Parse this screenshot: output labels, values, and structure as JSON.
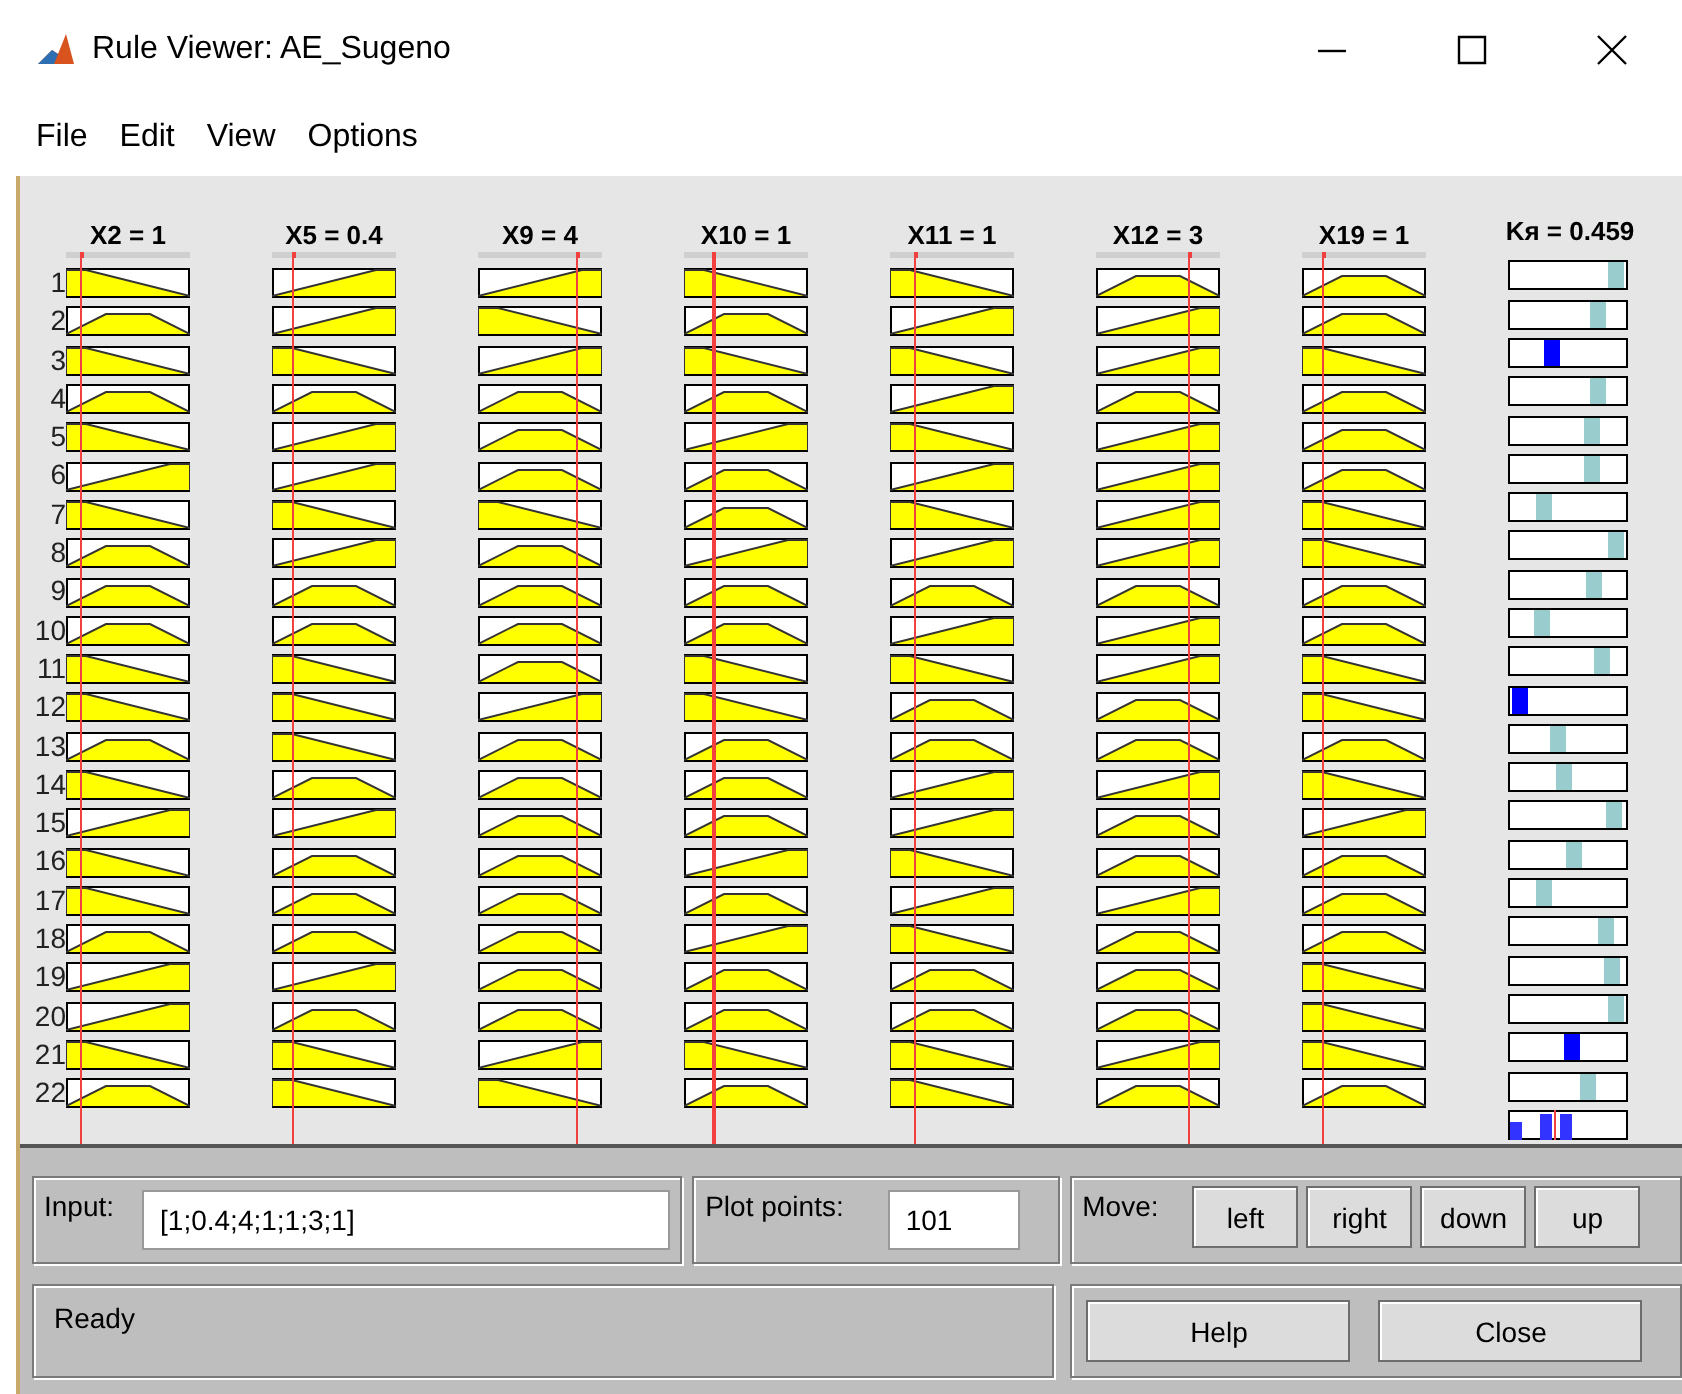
{
  "window": {
    "title": "Rule Viewer: AE_Sugeno"
  },
  "menu": [
    "File",
    "Edit",
    "View",
    "Options"
  ],
  "inputs": [
    {
      "label": "X2 = 1",
      "level": 0.11
    },
    {
      "label": "X5 = 0.4",
      "level": 0.16
    },
    {
      "label": "X9 = 4",
      "level": 0.79
    },
    {
      "label": "X10 = 1",
      "level": 0.23
    },
    {
      "label": "X11 = 1",
      "level": 0.19
    },
    {
      "label": "X12 = 3",
      "level": 0.74
    },
    {
      "label": "X19 = 1",
      "level": 0.16
    }
  ],
  "output": {
    "label": "Kя = 0.459"
  },
  "rules": [
    {
      "label": "1",
      "mfs": [
        {
          "kind": "down"
        },
        {
          "kind": "up"
        },
        {
          "kind": "up"
        },
        {
          "kind": "down"
        },
        {
          "kind": "down"
        },
        {
          "kind": "mid"
        },
        {
          "kind": "mid"
        }
      ],
      "output": {
        "level": 0.98,
        "active": false
      }
    },
    {
      "label": "2",
      "mfs": [
        {
          "kind": "mid"
        },
        {
          "kind": "up"
        },
        {
          "kind": "down"
        },
        {
          "kind": "mid"
        },
        {
          "kind": "up"
        },
        {
          "kind": "up"
        },
        {
          "kind": "mid"
        }
      ],
      "output": {
        "level": 0.8,
        "active": false
      }
    },
    {
      "label": "3",
      "mfs": [
        {
          "kind": "down"
        },
        {
          "kind": "down"
        },
        {
          "kind": "up"
        },
        {
          "kind": "down"
        },
        {
          "kind": "down"
        },
        {
          "kind": "up"
        },
        {
          "kind": "down"
        }
      ],
      "output": {
        "level": 0.33,
        "active": true
      }
    },
    {
      "label": "4",
      "mfs": [
        {
          "kind": "mid"
        },
        {
          "kind": "mid"
        },
        {
          "kind": "mid"
        },
        {
          "kind": "mid"
        },
        {
          "kind": "up"
        },
        {
          "kind": "mid"
        },
        {
          "kind": "mid"
        }
      ],
      "output": {
        "level": 0.79,
        "active": false
      }
    },
    {
      "label": "5",
      "mfs": [
        {
          "kind": "down"
        },
        {
          "kind": "up"
        },
        {
          "kind": "mid"
        },
        {
          "kind": "up"
        },
        {
          "kind": "down"
        },
        {
          "kind": "up"
        },
        {
          "kind": "mid"
        }
      ],
      "output": {
        "level": 0.73,
        "active": false
      }
    },
    {
      "label": "6",
      "mfs": [
        {
          "kind": "up"
        },
        {
          "kind": "up"
        },
        {
          "kind": "mid"
        },
        {
          "kind": "mid"
        },
        {
          "kind": "up"
        },
        {
          "kind": "up"
        },
        {
          "kind": "mid"
        }
      ],
      "output": {
        "level": 0.73,
        "active": false
      }
    },
    {
      "label": "7",
      "mfs": [
        {
          "kind": "down"
        },
        {
          "kind": "down"
        },
        {
          "kind": "down"
        },
        {
          "kind": "mid"
        },
        {
          "kind": "down"
        },
        {
          "kind": "up"
        },
        {
          "kind": "down"
        }
      ],
      "output": {
        "level": 0.25,
        "active": false
      }
    },
    {
      "label": "8",
      "mfs": [
        {
          "kind": "mid"
        },
        {
          "kind": "up"
        },
        {
          "kind": "mid"
        },
        {
          "kind": "up"
        },
        {
          "kind": "up"
        },
        {
          "kind": "up"
        },
        {
          "kind": "down"
        }
      ],
      "output": {
        "level": 0.98,
        "active": false
      }
    },
    {
      "label": "9",
      "mfs": [
        {
          "kind": "mid"
        },
        {
          "kind": "mid"
        },
        {
          "kind": "mid"
        },
        {
          "kind": "mid"
        },
        {
          "kind": "mid"
        },
        {
          "kind": "mid"
        },
        {
          "kind": "mid"
        }
      ],
      "output": {
        "level": 0.75,
        "active": false
      }
    },
    {
      "label": "10",
      "mfs": [
        {
          "kind": "mid"
        },
        {
          "kind": "mid"
        },
        {
          "kind": "mid"
        },
        {
          "kind": "mid"
        },
        {
          "kind": "up"
        },
        {
          "kind": "up"
        },
        {
          "kind": "mid"
        }
      ],
      "output": {
        "level": 0.23,
        "active": false
      }
    },
    {
      "label": "11",
      "mfs": [
        {
          "kind": "down"
        },
        {
          "kind": "down"
        },
        {
          "kind": "mid"
        },
        {
          "kind": "down"
        },
        {
          "kind": "down"
        },
        {
          "kind": "up"
        },
        {
          "kind": "down"
        }
      ],
      "output": {
        "level": 0.83,
        "active": false
      }
    },
    {
      "label": "12",
      "mfs": [
        {
          "kind": "down"
        },
        {
          "kind": "down"
        },
        {
          "kind": "up"
        },
        {
          "kind": "down"
        },
        {
          "kind": "mid"
        },
        {
          "kind": "mid"
        },
        {
          "kind": "down"
        }
      ],
      "output": {
        "level": 0.02,
        "active": true
      }
    },
    {
      "label": "13",
      "mfs": [
        {
          "kind": "mid"
        },
        {
          "kind": "down"
        },
        {
          "kind": "mid"
        },
        {
          "kind": "mid"
        },
        {
          "kind": "mid"
        },
        {
          "kind": "mid"
        },
        {
          "kind": "mid"
        }
      ],
      "output": {
        "level": 0.4,
        "active": false
      }
    },
    {
      "label": "14",
      "mfs": [
        {
          "kind": "down"
        },
        {
          "kind": "mid"
        },
        {
          "kind": "mid"
        },
        {
          "kind": "mid"
        },
        {
          "kind": "up"
        },
        {
          "kind": "up"
        },
        {
          "kind": "down"
        }
      ],
      "output": {
        "level": 0.46,
        "active": false
      }
    },
    {
      "label": "15",
      "mfs": [
        {
          "kind": "up"
        },
        {
          "kind": "up"
        },
        {
          "kind": "mid"
        },
        {
          "kind": "mid"
        },
        {
          "kind": "up"
        },
        {
          "kind": "mid"
        },
        {
          "kind": "up"
        }
      ],
      "output": {
        "level": 0.96,
        "active": false
      }
    },
    {
      "label": "16",
      "mfs": [
        {
          "kind": "down"
        },
        {
          "kind": "mid"
        },
        {
          "kind": "mid"
        },
        {
          "kind": "up"
        },
        {
          "kind": "down"
        },
        {
          "kind": "mid"
        },
        {
          "kind": "mid"
        }
      ],
      "output": {
        "level": 0.56,
        "active": false
      }
    },
    {
      "label": "17",
      "mfs": [
        {
          "kind": "down"
        },
        {
          "kind": "mid"
        },
        {
          "kind": "mid"
        },
        {
          "kind": "mid"
        },
        {
          "kind": "up"
        },
        {
          "kind": "up"
        },
        {
          "kind": "mid"
        }
      ],
      "output": {
        "level": 0.25,
        "active": false
      }
    },
    {
      "label": "18",
      "mfs": [
        {
          "kind": "mid"
        },
        {
          "kind": "mid"
        },
        {
          "kind": "mid"
        },
        {
          "kind": "up"
        },
        {
          "kind": "down"
        },
        {
          "kind": "mid"
        },
        {
          "kind": "mid"
        }
      ],
      "output": {
        "level": 0.88,
        "active": false
      }
    },
    {
      "label": "19",
      "mfs": [
        {
          "kind": "up"
        },
        {
          "kind": "up"
        },
        {
          "kind": "mid"
        },
        {
          "kind": "mid"
        },
        {
          "kind": "mid"
        },
        {
          "kind": "mid"
        },
        {
          "kind": "down"
        }
      ],
      "output": {
        "level": 0.94,
        "active": false
      }
    },
    {
      "label": "20",
      "mfs": [
        {
          "kind": "up"
        },
        {
          "kind": "mid"
        },
        {
          "kind": "mid"
        },
        {
          "kind": "mid"
        },
        {
          "kind": "mid"
        },
        {
          "kind": "mid"
        },
        {
          "kind": "down"
        }
      ],
      "output": {
        "level": 0.98,
        "active": false
      }
    },
    {
      "label": "21",
      "mfs": [
        {
          "kind": "down"
        },
        {
          "kind": "down"
        },
        {
          "kind": "up"
        },
        {
          "kind": "down"
        },
        {
          "kind": "down"
        },
        {
          "kind": "up"
        },
        {
          "kind": "down"
        }
      ],
      "output": {
        "level": 0.54,
        "active": true
      }
    },
    {
      "label": "22",
      "mfs": [
        {
          "kind": "mid"
        },
        {
          "kind": "down"
        },
        {
          "kind": "down"
        },
        {
          "kind": "mid"
        },
        {
          "kind": "down"
        },
        {
          "kind": "mid"
        },
        {
          "kind": "mid"
        }
      ],
      "output": {
        "level": 0.69,
        "active": false
      }
    }
  ],
  "input_panel": {
    "label": "Input:",
    "value": "[1;0.4;4;1;1;3;1]"
  },
  "plot_points": {
    "label": "Plot points:",
    "value": "101"
  },
  "move": {
    "label": "Move:",
    "buttons": [
      "left",
      "right",
      "down",
      "up"
    ]
  },
  "status": "Ready",
  "buttons": [
    "Help",
    "Close"
  ]
}
